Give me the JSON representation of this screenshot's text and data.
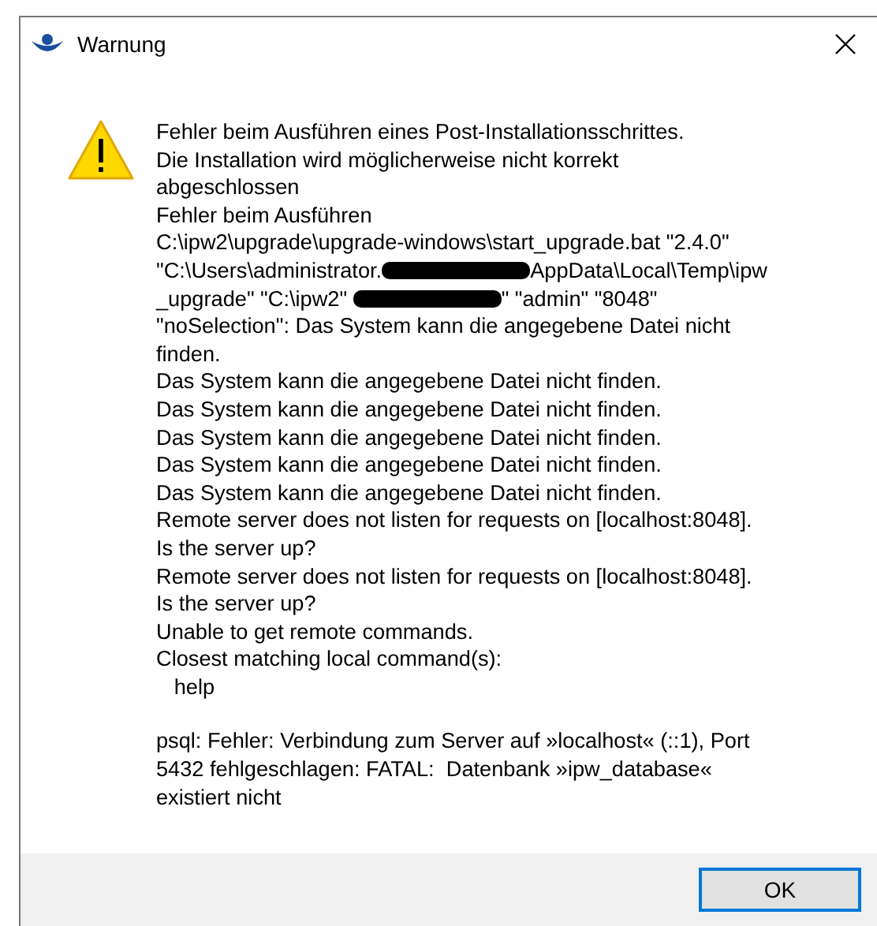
{
  "window": {
    "title": "Warnung"
  },
  "message": {
    "paragraphs": [
      {
        "lines": [
          [
            {
              "kind": "text",
              "text": "Fehler beim Ausführen eines Post-Installationsschrittes."
            }
          ],
          [
            {
              "kind": "text",
              "text": "Die Installation wird möglicherweise nicht korrekt"
            }
          ],
          [
            {
              "kind": "text",
              "text": "abgeschlossen"
            }
          ],
          [
            {
              "kind": "text",
              "text": "Fehler beim Ausführen"
            }
          ],
          [
            {
              "kind": "text",
              "text": "C:\\ipw2\\upgrade\\upgrade-windows\\start_upgrade.bat \"2.4.0\""
            }
          ],
          [
            {
              "kind": "text",
              "text": "\"C:\\Users\\administrator."
            },
            {
              "kind": "redaction"
            },
            {
              "kind": "text",
              "text": "AppData\\Local\\Temp\\ipw"
            }
          ],
          [
            {
              "kind": "text",
              "text": "_upgrade\" \"C:\\ipw2\" "
            },
            {
              "kind": "redaction"
            },
            {
              "kind": "text",
              "text": "\" \"admin\" \"8048\""
            }
          ],
          [
            {
              "kind": "text",
              "text": "\"noSelection\": Das System kann die angegebene Datei nicht"
            }
          ],
          [
            {
              "kind": "text",
              "text": "finden."
            }
          ],
          [
            {
              "kind": "text",
              "text": "Das System kann die angegebene Datei nicht finden."
            }
          ],
          [
            {
              "kind": "text",
              "text": "Das System kann die angegebene Datei nicht finden."
            }
          ],
          [
            {
              "kind": "text",
              "text": "Das System kann die angegebene Datei nicht finden."
            }
          ],
          [
            {
              "kind": "text",
              "text": "Das System kann die angegebene Datei nicht finden."
            }
          ],
          [
            {
              "kind": "text",
              "text": "Das System kann die angegebene Datei nicht finden."
            }
          ],
          [
            {
              "kind": "text",
              "text": "Remote server does not listen for requests on [localhost:8048]."
            }
          ],
          [
            {
              "kind": "text",
              "text": "Is the server up?"
            }
          ],
          [
            {
              "kind": "text",
              "text": "Remote server does not listen for requests on [localhost:8048]."
            }
          ],
          [
            {
              "kind": "text",
              "text": "Is the server up?"
            }
          ],
          [
            {
              "kind": "text",
              "text": "Unable to get remote commands."
            }
          ],
          [
            {
              "kind": "text",
              "text": "Closest matching local command(s):"
            }
          ],
          [
            {
              "kind": "text",
              "text": "   help"
            }
          ]
        ]
      },
      {
        "lines": [
          [
            {
              "kind": "text",
              "text": "psql: Fehler: Verbindung zum Server auf »localhost« (::1), Port"
            }
          ],
          [
            {
              "kind": "text",
              "text": "5432 fehlgeschlagen: FATAL:  Datenbank »ipw_database«"
            }
          ],
          [
            {
              "kind": "text",
              "text": "existiert nicht"
            }
          ]
        ]
      }
    ]
  },
  "buttons": [
    "OK"
  ]
}
